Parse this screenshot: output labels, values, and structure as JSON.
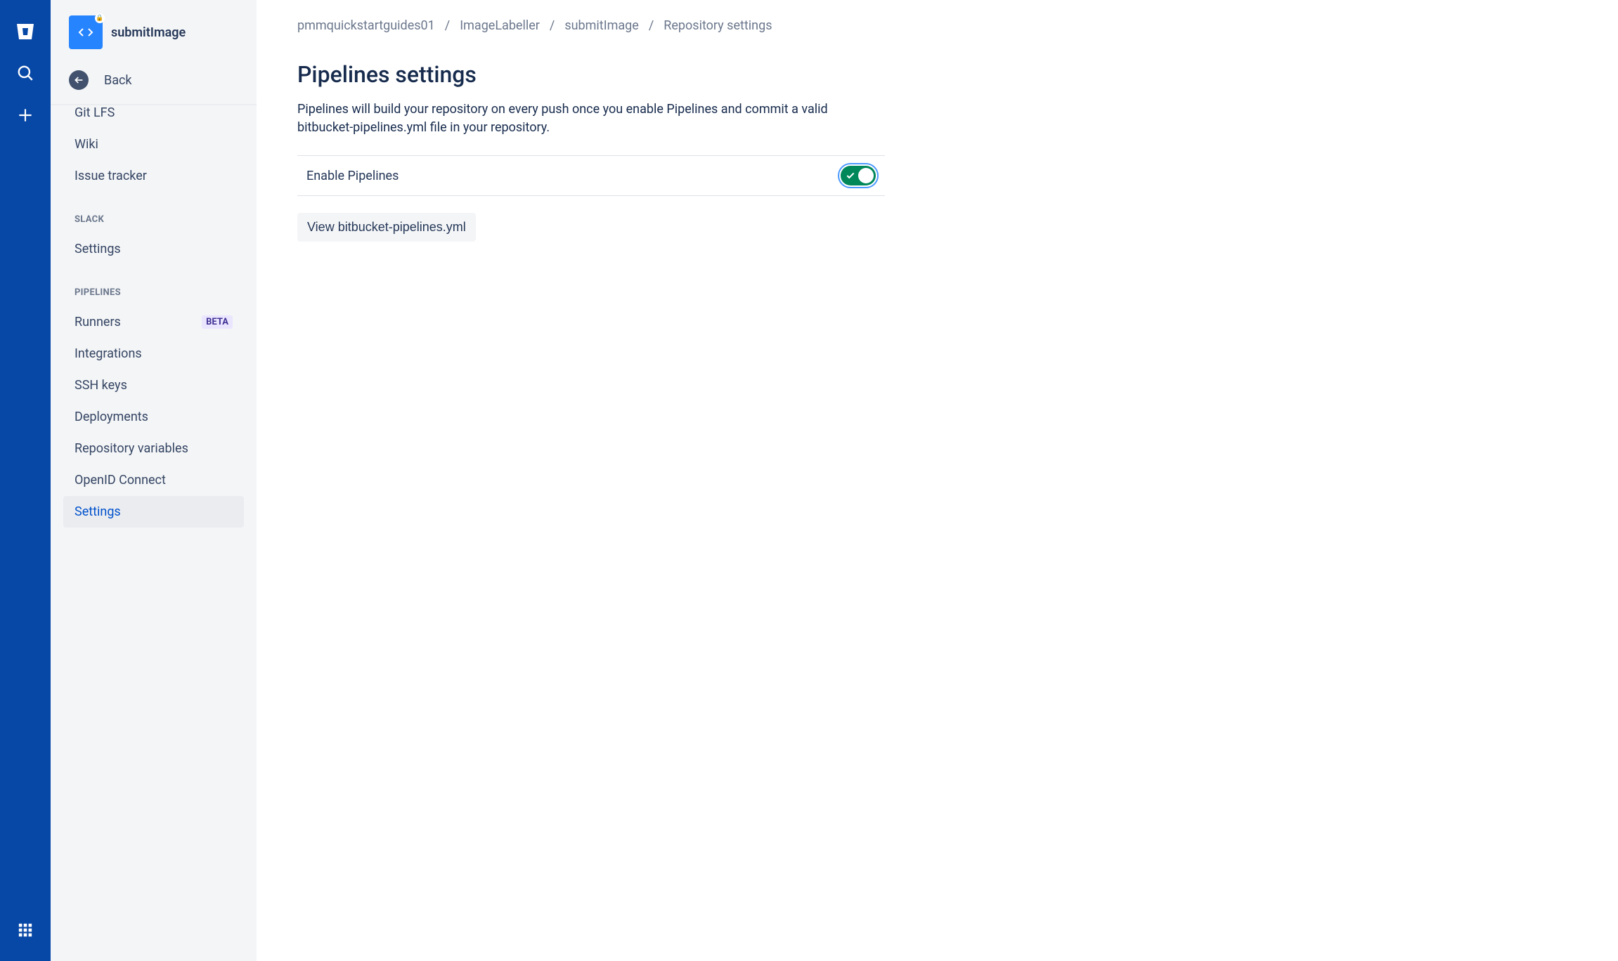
{
  "globalNav": {
    "logo": "bitbucket-logo",
    "search": "search",
    "create": "create",
    "apps": "apps"
  },
  "sidebar": {
    "repoName": "submitImage",
    "backLabel": "Back",
    "items": [
      {
        "label": "Git LFS",
        "type": "item",
        "cut": true
      },
      {
        "label": "Wiki",
        "type": "item"
      },
      {
        "label": "Issue tracker",
        "type": "item"
      },
      {
        "label": "SLACK",
        "type": "group"
      },
      {
        "label": "Settings",
        "type": "item"
      },
      {
        "label": "PIPELINES",
        "type": "group"
      },
      {
        "label": "Runners",
        "type": "item",
        "badge": "BETA"
      },
      {
        "label": "Integrations",
        "type": "item"
      },
      {
        "label": "SSH keys",
        "type": "item"
      },
      {
        "label": "Deployments",
        "type": "item"
      },
      {
        "label": "Repository variables",
        "type": "item"
      },
      {
        "label": "OpenID Connect",
        "type": "item"
      },
      {
        "label": "Settings",
        "type": "item",
        "selected": true
      }
    ]
  },
  "breadcrumbs": [
    "pmmquickstartguides01",
    "ImageLabeller",
    "submitImage",
    "Repository settings"
  ],
  "main": {
    "title": "Pipelines settings",
    "description": "Pipelines will build your repository on every push once you enable Pipelines and commit a valid bitbucket-pipelines.yml file in your repository.",
    "toggleLabel": "Enable Pipelines",
    "toggleEnabled": true,
    "viewButtonLabel": "View bitbucket-pipelines.yml"
  }
}
